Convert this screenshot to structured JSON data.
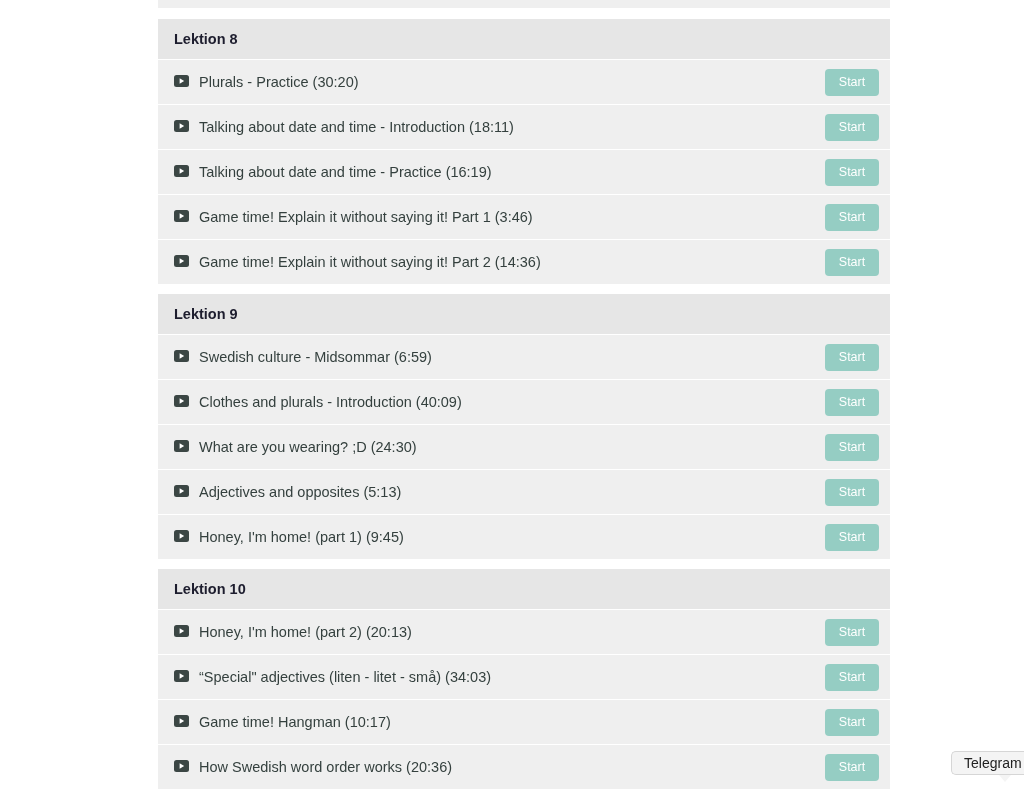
{
  "sections": [
    {
      "title": "Lektion 8",
      "lessons": [
        {
          "title": "Plurals - Practice (30:20)",
          "button": "Start"
        },
        {
          "title": "Talking about date and time - Introduction (18:11)",
          "button": "Start"
        },
        {
          "title": "Talking about date and time - Practice (16:19)",
          "button": "Start"
        },
        {
          "title": "Game time! Explain it without saying it! Part 1 (3:46)",
          "button": "Start"
        },
        {
          "title": "Game time! Explain it without saying it! Part 2 (14:36)",
          "button": "Start"
        }
      ]
    },
    {
      "title": "Lektion 9",
      "lessons": [
        {
          "title": "Swedish culture - Midsommar (6:59)",
          "button": "Start"
        },
        {
          "title": "Clothes and plurals - Introduction (40:09)",
          "button": "Start"
        },
        {
          "title": "What are you wearing? ;D (24:30)",
          "button": "Start"
        },
        {
          "title": "Adjectives and opposites (5:13)",
          "button": "Start"
        },
        {
          "title": "Honey, I'm home! (part 1) (9:45)",
          "button": "Start"
        }
      ]
    },
    {
      "title": "Lektion 10",
      "lessons": [
        {
          "title": "Honey, I'm home! (part 2) (20:13)",
          "button": "Start"
        },
        {
          "title": "“Special\" adjectives (liten - litet - små) (34:03)",
          "button": "Start"
        },
        {
          "title": "Game time! Hangman (10:17)",
          "button": "Start"
        },
        {
          "title": "How Swedish word order works (20:36)",
          "button": "Start"
        }
      ]
    }
  ],
  "dock_tooltip": {
    "label": "Telegram"
  }
}
